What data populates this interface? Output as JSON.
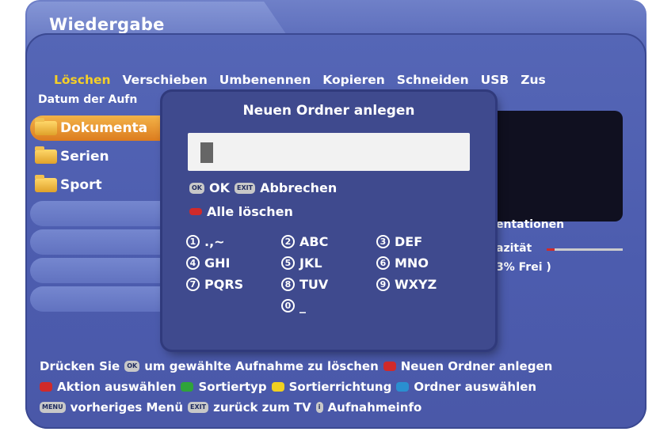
{
  "window": {
    "title": "Wiedergabe"
  },
  "menu": {
    "items": [
      "Löschen",
      "Verschieben",
      "Umbenennen",
      "Kopieren",
      "Schneiden",
      "USB",
      "Zus"
    ],
    "active_index": 0
  },
  "list": {
    "header": "Datum der Aufn",
    "items": [
      {
        "label": "Dokumenta",
        "selected": true
      },
      {
        "label": "Serien"
      },
      {
        "label": "Sport"
      },
      {
        "label": ""
      },
      {
        "label": ""
      },
      {
        "label": ""
      },
      {
        "label": ""
      }
    ]
  },
  "preview": {
    "label": "entationen",
    "capacity_label": "azität",
    "free_label": "3% Frei )",
    "capacity_used_fraction": 0.1
  },
  "dialog": {
    "title": "Neuen Ordner anlegen",
    "input_value": "",
    "ok_key": "OK",
    "ok_label": "OK",
    "cancel_key": "EXIT",
    "cancel_label": "Abbrechen",
    "clear_label": "Alle löschen",
    "keypad": [
      {
        "num": "1",
        "chars": ".,~"
      },
      {
        "num": "2",
        "chars": "ABC"
      },
      {
        "num": "3",
        "chars": "DEF"
      },
      {
        "num": "4",
        "chars": "GHI"
      },
      {
        "num": "5",
        "chars": "JKL"
      },
      {
        "num": "6",
        "chars": "MNO"
      },
      {
        "num": "7",
        "chars": "PQRS"
      },
      {
        "num": "8",
        "chars": "TUV"
      },
      {
        "num": "9",
        "chars": "WXYZ"
      },
      {
        "num": "0",
        "chars": "_"
      }
    ]
  },
  "help": {
    "row1_prefix": "Drücken Sie",
    "row1_middle": "um gewählte Aufnahme zu löschen",
    "row1_suffix": "Neuen Ordner anlegen",
    "row2": [
      "Aktion auswählen",
      "Sortiertyp",
      "Sortierrichtung",
      "Ordner auswählen"
    ],
    "row3_menu_key": "MENU",
    "row3_menu": "vorheriges Menü",
    "row3_exit_key": "EXIT",
    "row3_exit": "zurück zum TV",
    "row3_info_key": "i",
    "row3_info": "Aufnahmeinfo"
  },
  "colors": {
    "red": "#d02a2a",
    "green": "#2fa33a",
    "yellow": "#f0d020",
    "blue": "#2a8fd0",
    "accent": "#f5cf27"
  }
}
